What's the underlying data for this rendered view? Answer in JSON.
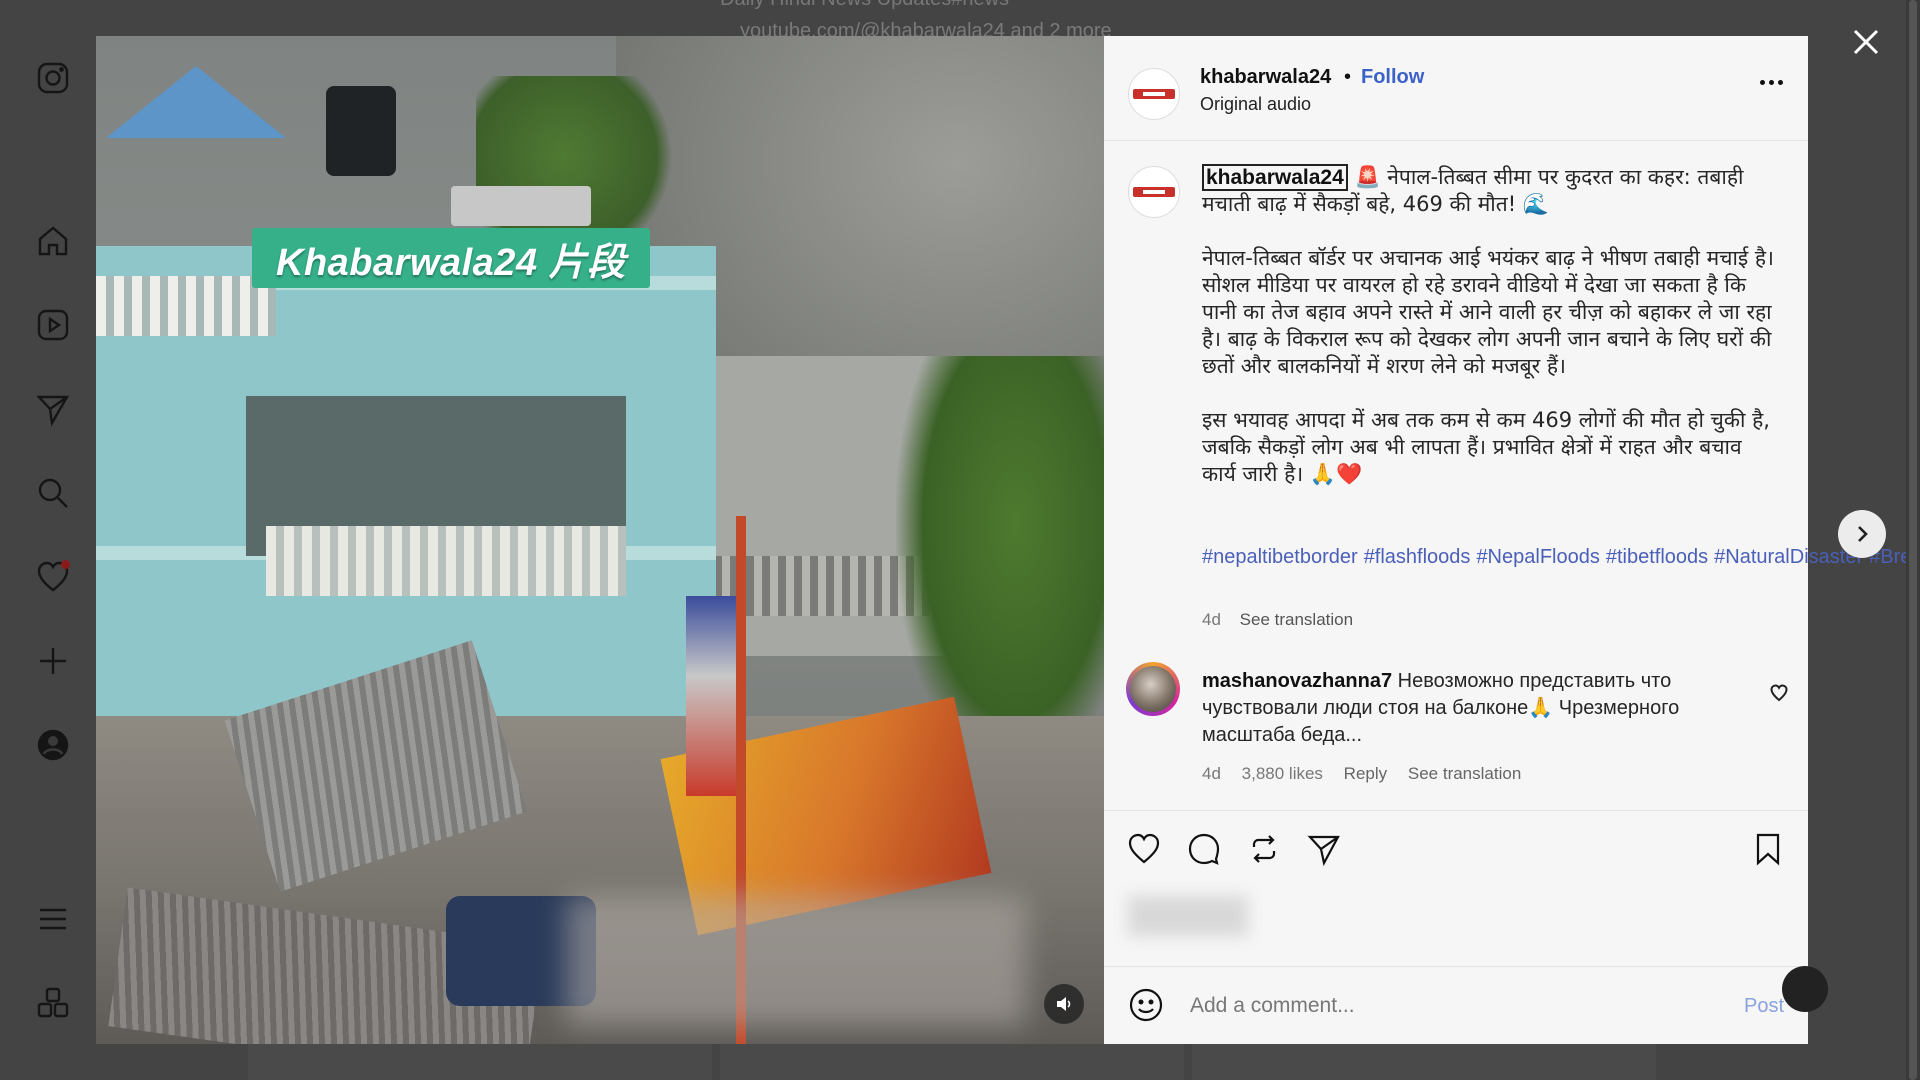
{
  "background": {
    "top_line1": "Daily Hindi News Updates#news",
    "top_line2": "youtube.com/@khabarwala24 and 2 more"
  },
  "rail": {
    "icons": [
      "instagram-icon",
      "home-icon",
      "reels-icon",
      "messages-icon",
      "search-icon",
      "notifications-icon",
      "create-icon",
      "profile-icon",
      "menu-icon",
      "more-apps-icon"
    ]
  },
  "media": {
    "label": "Khabarwala24 片段"
  },
  "post": {
    "username": "khabarwala24",
    "dot": "•",
    "follow_label": "Follow",
    "audio": "Original audio"
  },
  "caption": {
    "username": "khabarwala24",
    "line1": "🚨 नेपाल-तिब्बत सीमा पर कुदरत का कहर: तबाही मचाती बाढ़ में सैकड़ों बहे, 469 की मौत! 🌊",
    "para2": "नेपाल-तिब्बत बॉर्डर पर अचानक आई भयंकर बाढ़ ने भीषण तबाही मचाई है। सोशल मीडिया पर वायरल हो रहे डरावने वीडियो में देखा जा सकता है कि पानी का तेज बहाव अपने रास्ते में आने वाली हर चीज़ को बहाकर ले जा रहा है। बाढ़ के विकराल रूप को देखकर लोग अपनी जान बचाने के लिए घरों की छतों और बालकनियों में शरण लेने को मजबूर हैं।",
    "para3": "इस भयावह आपदा में अब तक कम से कम 469 लोगों की मौत हो चुकी है, जबकि सैकड़ों लोग अब भी लापता हैं। प्रभावित क्षेत्रों में राहत और बचाव कार्य जारी है। 🙏❤️",
    "hashtags": [
      "#nepaltibetborder",
      "#flashfloods",
      "#NepalFloods",
      "#tibetfloods",
      "#NaturalDisaster",
      "#BreakingNews"
    ],
    "age": "4d",
    "see_translation": "See translation"
  },
  "comment": {
    "username": "mashanovazhanna7",
    "text": "Невозможно представить что чувствовали люди стоя на балконе🙏 Чрезмерного масштаба беда...",
    "age": "4d",
    "likes": "3,880 likes",
    "reply": "Reply",
    "see_translation": "See translation"
  },
  "add_comment": {
    "placeholder": "Add a comment...",
    "post_label": "Post"
  },
  "colors": {
    "follow": "#3c62c8",
    "hashtag": "#4a5fb8",
    "video_label_bg": "#35b089"
  }
}
